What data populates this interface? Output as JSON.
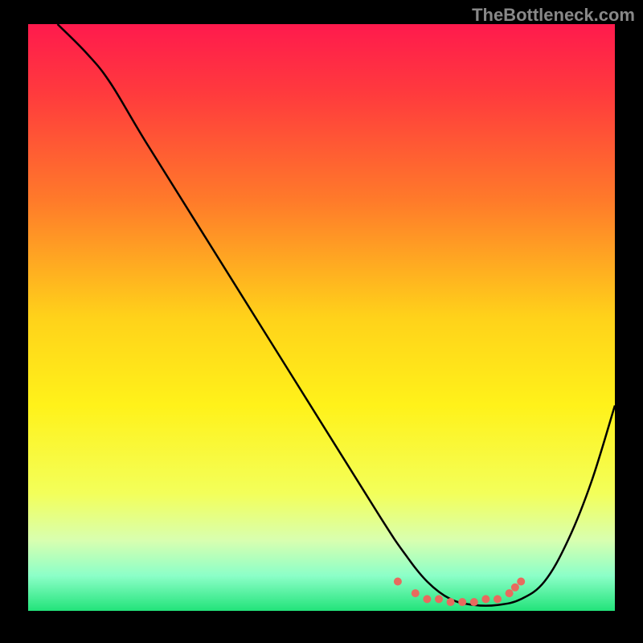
{
  "watermark": "TheBottleneck.com",
  "chart_data": {
    "type": "line",
    "title": "",
    "xlabel": "",
    "ylabel": "",
    "xlim": [
      0,
      100
    ],
    "ylim": [
      0,
      100
    ],
    "background_gradient": {
      "stops": [
        {
          "offset": 0,
          "color": "#ff1a4d"
        },
        {
          "offset": 12,
          "color": "#ff3b3d"
        },
        {
          "offset": 30,
          "color": "#ff7a2a"
        },
        {
          "offset": 50,
          "color": "#ffd21a"
        },
        {
          "offset": 65,
          "color": "#fff21a"
        },
        {
          "offset": 80,
          "color": "#f3ff5a"
        },
        {
          "offset": 88,
          "color": "#d8ffb0"
        },
        {
          "offset": 94,
          "color": "#8cffc8"
        },
        {
          "offset": 100,
          "color": "#22e37a"
        }
      ]
    },
    "series": [
      {
        "name": "bottleneck-curve",
        "color": "#000000",
        "x": [
          5,
          10,
          14,
          20,
          30,
          40,
          50,
          60,
          64,
          68,
          72,
          76,
          80,
          84,
          88,
          92,
          96,
          100
        ],
        "values": [
          100,
          95,
          90,
          80,
          64,
          48,
          32,
          16,
          10,
          5,
          2,
          1,
          1,
          2,
          5,
          12,
          22,
          35
        ]
      }
    ],
    "markers": {
      "name": "optimal-zone-dots",
      "color": "#e86a5e",
      "x": [
        63,
        66,
        68,
        70,
        72,
        74,
        76,
        78,
        80,
        82,
        83,
        84
      ],
      "values": [
        5,
        3,
        2,
        2,
        1.5,
        1.5,
        1.5,
        2,
        2,
        3,
        4,
        5
      ]
    }
  }
}
